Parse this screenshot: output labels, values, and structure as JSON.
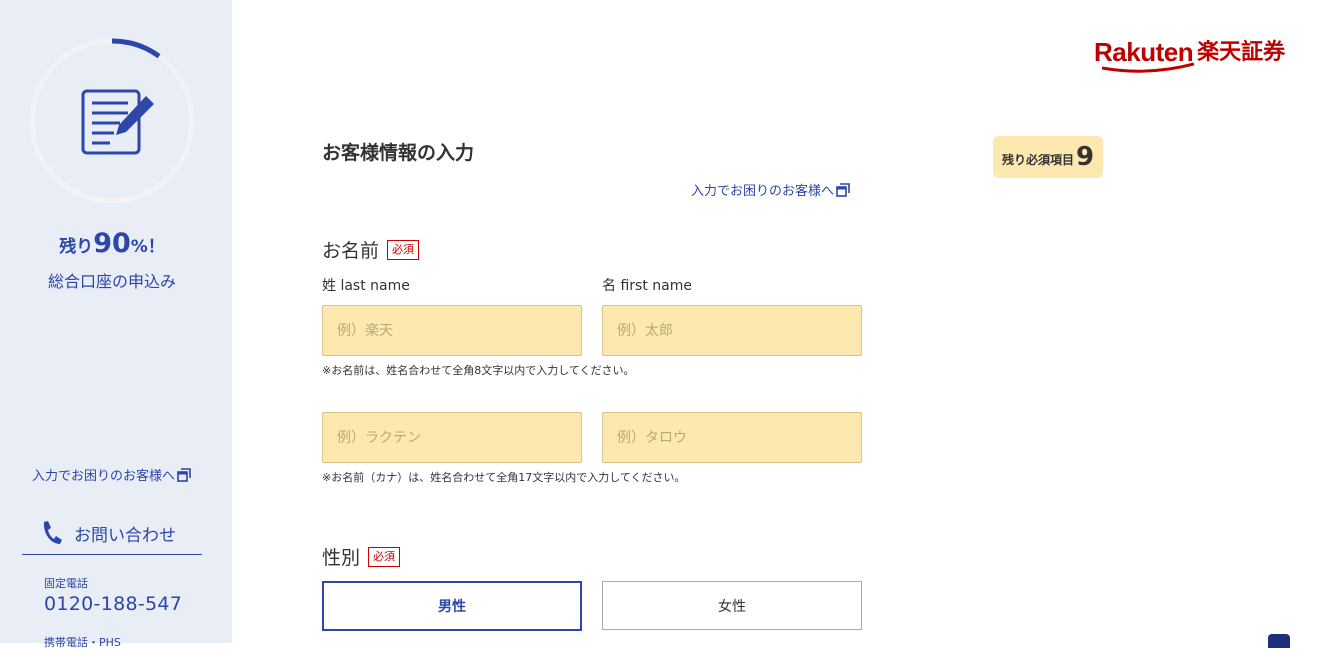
{
  "sidebar": {
    "progress_percent": 10,
    "remaining_prefix": "残り",
    "remaining_value": "90",
    "remaining_suffix": "%！",
    "application_title": "総合口座の申込み",
    "help_link": "入力でお困りのお客様へ",
    "contact_label": "お問い合わせ",
    "landline_label": "固定電話",
    "landline_number": "0120-188-547",
    "mobile_label": "携帯電話・PHS"
  },
  "logo": {
    "brand_en": "Rakuten",
    "brand_jp": "楽天証券",
    "color": "#bf0000"
  },
  "main": {
    "title": "お客様情報の入力",
    "help_link": "入力でお困りのお客様へ",
    "required_remaining_label": "残り必須項目",
    "required_remaining_count": "9"
  },
  "name_section": {
    "label": "お名前",
    "required": "必須",
    "last_name_label": "姓 last name",
    "first_name_label": "名 first name",
    "last_name_placeholder": "例）楽天",
    "first_name_placeholder": "例）太郎",
    "name_note": "※お名前は、姓名合わせて全角8文字以内で入力してください。",
    "last_kana_placeholder": "例）ラクテン",
    "first_kana_placeholder": "例）タロウ",
    "kana_note": "※お名前（カナ）は、姓名合わせて全角17文字以内で入力してください。"
  },
  "gender_section": {
    "label": "性別",
    "required": "必須",
    "options": [
      "男性",
      "女性"
    ],
    "selected": "男性"
  },
  "colors": {
    "accent": "#2c46a9",
    "input_bg": "#fde8b0",
    "required_red": "#cc0000",
    "sidebar_bg": "#e9edf6"
  }
}
